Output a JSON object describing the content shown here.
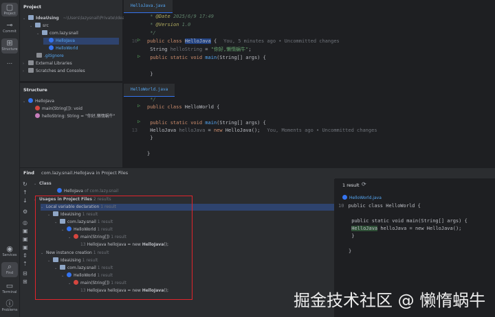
{
  "toolbar": {
    "project": "Project",
    "commit": "Commit",
    "structure": "Structure",
    "more": "...",
    "services": "Services",
    "find": "Find",
    "terminal": "Terminal",
    "problems": "Problems"
  },
  "project_panel": {
    "title": "Project",
    "root_name": "IdeaUsing",
    "root_path": "~\\Users\\lazysnail\\Private\\IdeaU",
    "src": "src",
    "package": "com.lazy.snail",
    "file1": "HelloJava",
    "file2": "HelloWorld",
    "gitignore": ".gitignore",
    "ext_libs": "External Libraries",
    "scratches": "Scratches and Consoles"
  },
  "structure_panel": {
    "title": "Structure",
    "class_name": "HelloJava",
    "method": "main(String[]): void",
    "field": "helloString: String = \"你好,懒惰蜗牛\""
  },
  "editor1": {
    "tab": "HelloJava.java",
    "lines": [
      {
        "n": "",
        "a": " * ",
        "b": "@Date",
        "c": " 2025/6/9 17:49"
      },
      {
        "n": "",
        "a": " * ",
        "b": "@Version",
        "c": " 1.0"
      },
      {
        "n": "",
        "a": " */",
        "b": "",
        "c": ""
      },
      {
        "n": "10",
        "kw": "public class ",
        "name": "HelloJava",
        "rest": " {",
        "hint": "You, 5 minutes ago • Uncommitted changes"
      },
      {
        "n": "",
        "pre": "    String ",
        "v": "helloString",
        "eq": " = ",
        "s": "\"你好,懒惰蜗牛\"",
        "end": ";"
      },
      {
        "n": "",
        "kw": "    public static void ",
        "m": "main",
        "rest": "(String[] args) {"
      },
      {
        "n": "",
        "rest": ""
      },
      {
        "n": "",
        "rest": "    }"
      },
      {
        "n": "",
        "rest": "}"
      }
    ]
  },
  "editor2": {
    "tab": "HelloWorld.java",
    "l1": " */",
    "l2_kw": "public class ",
    "l2_rest": "HelloWorld {",
    "l3_kw": "    public static void ",
    "l3_m": "main",
    "l3_rest": "(String[] args) {",
    "l4_n": "13",
    "l4_a": "        HelloJava ",
    "l4_v": "helloJava",
    "l4_b": " = ",
    "l4_kw": "new ",
    "l4_c": "HelloJava();",
    "l4_hint": "You, Moments ago • Uncommitted changes",
    "l5": "    }",
    "l6": "}"
  },
  "find": {
    "tab_label": "Find",
    "tab_title": "com.lazy.snail.HelloJava in Project Files",
    "tab_close": "×",
    "class_header": "Class",
    "class_item": "HelloJava",
    "class_item_suffix": "of com.lazy.snail",
    "usages": "Usages in Project Files",
    "usages_count": "2 results",
    "local_decl": "Local variable declaration",
    "local_count": "1 result",
    "new_inst": "New instance creation",
    "new_count": "1 result",
    "idea": "IdeaUsing",
    "pkg": "com.lazy.snail",
    "hw": "HelloWorld",
    "main": "main(String[])",
    "one_result": "1 result",
    "line_no": "13",
    "code_a": "HelloJava helloJava = new ",
    "code_b": "HelloJava",
    "code_c": "();"
  },
  "preview": {
    "count": "1 result",
    "file": "HelloWorld.java",
    "ln10": "10",
    "l1": "public class HelloWorld {",
    "l2": "    public static void main(String[] args) {",
    "l3a": "        ",
    "l3b": "HelloJava",
    "l3c": " helloJava = new HelloJava();",
    "l4": "    }",
    "l5": "}"
  },
  "watermark": "掘金技术社区 @ 懒惰蜗牛",
  "colors": {
    "accent": "#3574f0",
    "highlight_box": "#e3242b"
  }
}
